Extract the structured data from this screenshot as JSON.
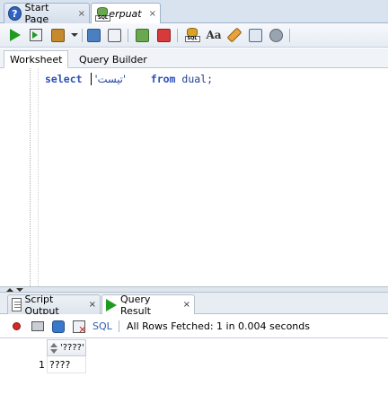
{
  "doc_tabs": [
    {
      "label": "Start Page",
      "icon": "help-icon",
      "close": "×",
      "active": false
    },
    {
      "label": "erpuat",
      "icon": "sql-connection-icon",
      "close": "×",
      "active": true
    }
  ],
  "toolbar": {
    "icons": [
      "run-statement-icon",
      "run-script-icon",
      "commit-icon",
      "dropdown-icon",
      "explain-plan-icon",
      "autotrace-icon",
      "commit-transaction-icon",
      "rollback-icon",
      "sql-tuning-icon",
      "format-case-icon",
      "clear-icon",
      "history-icon",
      "tools-icon"
    ],
    "case_label": "Aa"
  },
  "worksheet_tabs": [
    {
      "label": "Worksheet",
      "active": true
    },
    {
      "label": "Query Builder",
      "active": false
    }
  ],
  "editor": {
    "keyword_select": "select",
    "string_literal": "'تيست'",
    "keyword_from": "from",
    "table": "dual;"
  },
  "result_tabs": [
    {
      "label": "Script Output",
      "icon": "script-output-icon",
      "close": "×",
      "active": false
    },
    {
      "label": "Query Result",
      "icon": "query-result-icon",
      "close": "×",
      "active": true
    }
  ],
  "result_toolbar": {
    "sql_label": "SQL",
    "status": "All Rows Fetched: 1 in 0.004 seconds"
  },
  "grid": {
    "column_header": "'????'",
    "rows": [
      {
        "num": "1",
        "value": "????"
      }
    ]
  }
}
